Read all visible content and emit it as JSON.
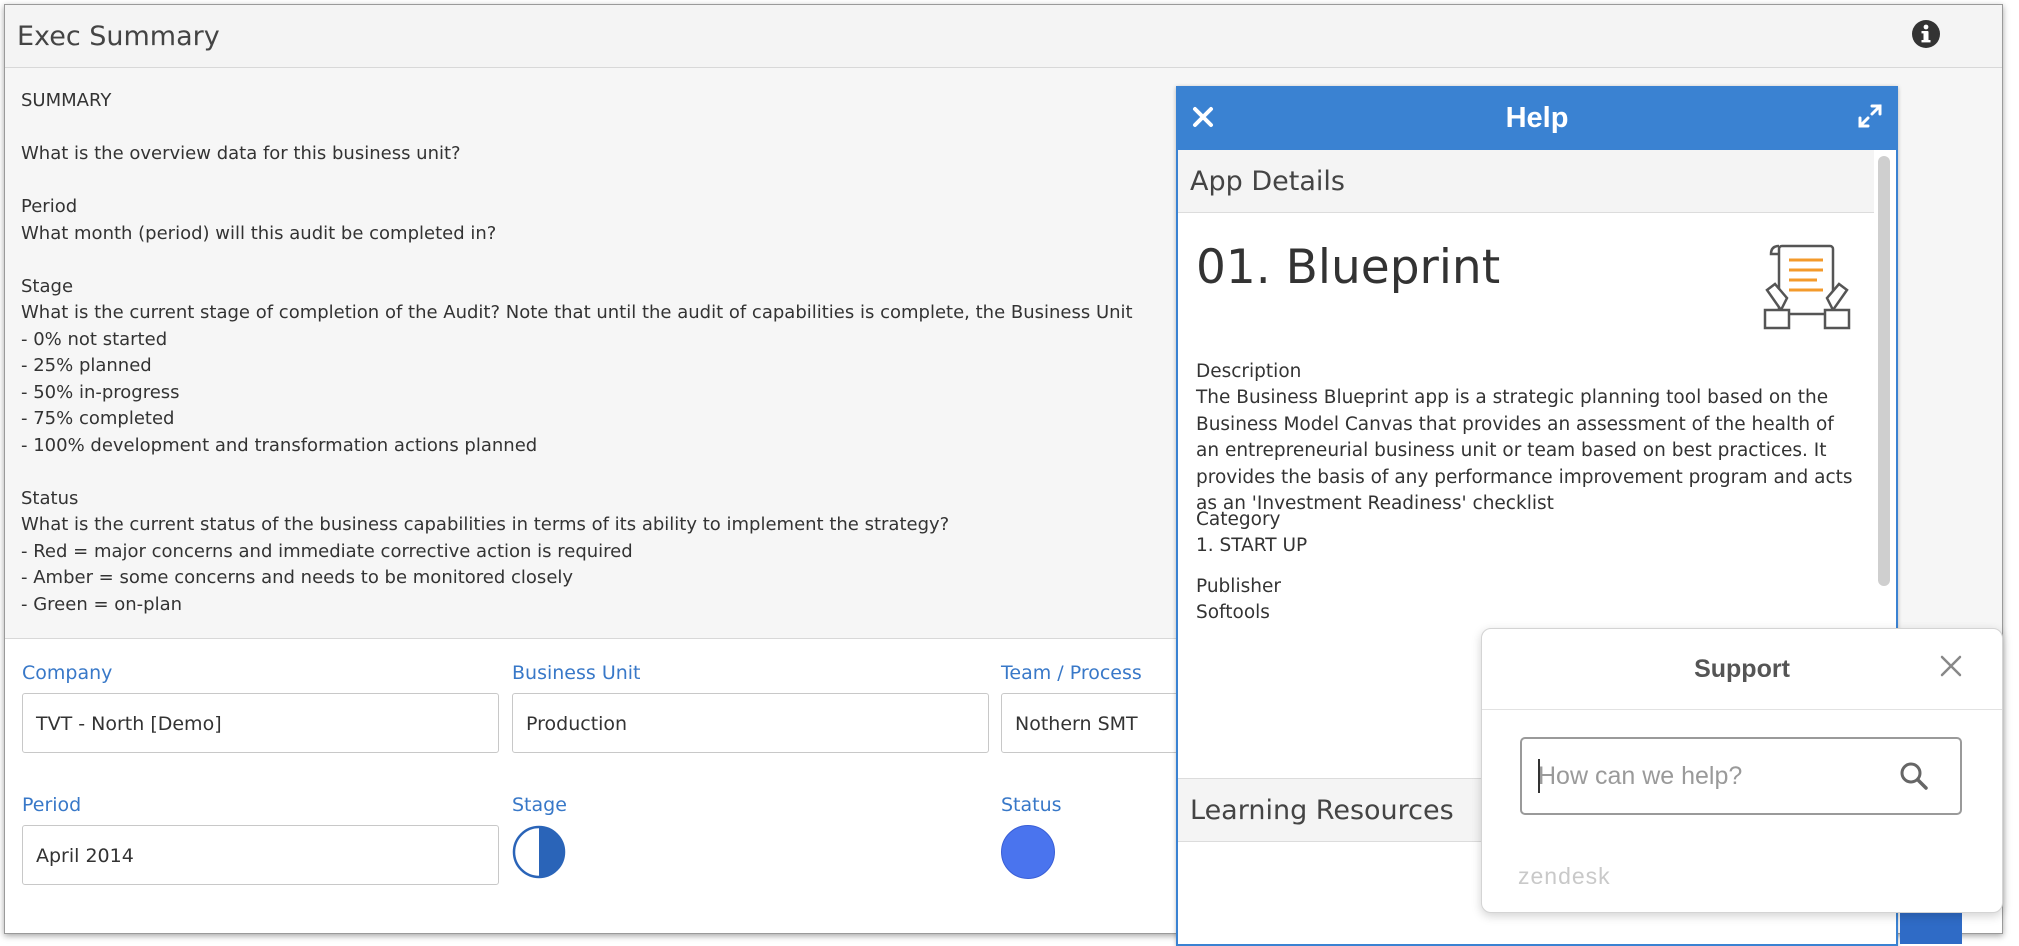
{
  "app": {
    "title": "Exec Summary"
  },
  "summary": {
    "text": "SUMMARY\n\nWhat is the overview data for this business unit?\n\nPeriod\nWhat month (period) will this audit be completed in?\n\nStage\nWhat is the current stage of completion of the Audit? Note that until the audit of capabilities is complete, the Business Unit\n- 0% not started\n- 25% planned\n- 50% in-progress\n- 75% completed\n- 100% development and transformation actions planned\n\nStatus\nWhat is the current status of the business capabilities in terms of its ability to implement the strategy?\n- Red = major concerns and immediate corrective action is required\n- Amber = some concerns and needs to be monitored closely\n- Green = on-plan"
  },
  "fields": {
    "company_label": "Company",
    "company_value": "TVT - North [Demo]",
    "business_unit_label": "Business Unit",
    "business_unit_value": "Production",
    "team_label": "Team / Process",
    "team_value": "Nothern SMT",
    "period_label": "Period",
    "period_value": "April 2014",
    "stage_label": "Stage",
    "stage_value_percent": 50,
    "status_label": "Status",
    "status_color": "#4a74ee"
  },
  "help": {
    "title": "Help",
    "close_icon": "close-icon",
    "expand_icon": "expand-icon",
    "app_details_title": "App Details",
    "app_name": "01. Blueprint",
    "app_icon": "blueprint-document-icon",
    "description_label": "Description",
    "description_text": "The Business Blueprint app is a strategic planning tool based on the Business Model Canvas that provides an assessment of the health of an entrepreneurial business unit or team based on best practices. It provides the basis of any performance improvement program and acts as an 'Investment Readiness' checklist",
    "category_label": "Category",
    "category_value": "1. START UP",
    "publisher_label": "Publisher",
    "publisher_value": "Softools",
    "learning_resources_title": "Learning Resources"
  },
  "support": {
    "title": "Support",
    "search_placeholder": "How can we help?",
    "search_value": "",
    "brand": "zendesk"
  },
  "colors": {
    "accent": "#3a82d2",
    "label_blue": "#3878c8",
    "status_blue": "#4a74ee"
  }
}
